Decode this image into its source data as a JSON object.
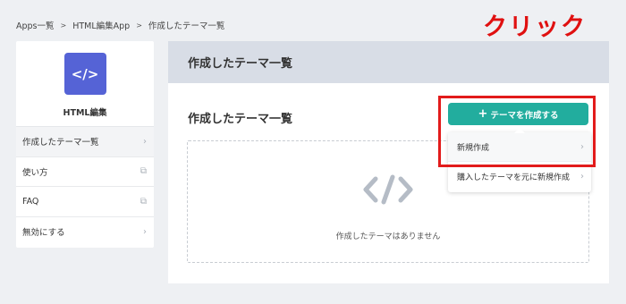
{
  "breadcrumb": {
    "items": [
      "Apps一覧",
      "HTML編集App",
      "作成したテーマ一覧"
    ],
    "separator": ">"
  },
  "annotation": {
    "text": "クリック",
    "color": "#e01010"
  },
  "sidebar": {
    "app_icon": "code-icon",
    "app_icon_glyph": "</>",
    "app_name": "HTML編集",
    "items": [
      {
        "label": "作成したテーマ一覧",
        "icon": "chevron-right-icon",
        "glyph": "›"
      },
      {
        "label": "使い方",
        "icon": "external-link-icon",
        "glyph": "⧉"
      },
      {
        "label": "FAQ",
        "icon": "external-link-icon",
        "glyph": "⧉"
      },
      {
        "label": "無効にする",
        "icon": "chevron-right-icon",
        "glyph": "›"
      }
    ]
  },
  "main": {
    "header_title": "作成したテーマ一覧",
    "section_title": "作成したテーマ一覧",
    "create_button": {
      "plus": "+",
      "label": "テーマを作成する"
    },
    "dropdown": {
      "items": [
        {
          "label": "新規作成",
          "glyph": "›"
        },
        {
          "label": "購入したテーマを元に新規作成",
          "glyph": "›"
        }
      ]
    },
    "empty_state": {
      "icon": "code-icon",
      "text": "作成したテーマはありません"
    }
  },
  "colors": {
    "accent_button": "#22ad9e",
    "app_icon_bg": "#5563d6",
    "highlight": "#e21b1b"
  }
}
